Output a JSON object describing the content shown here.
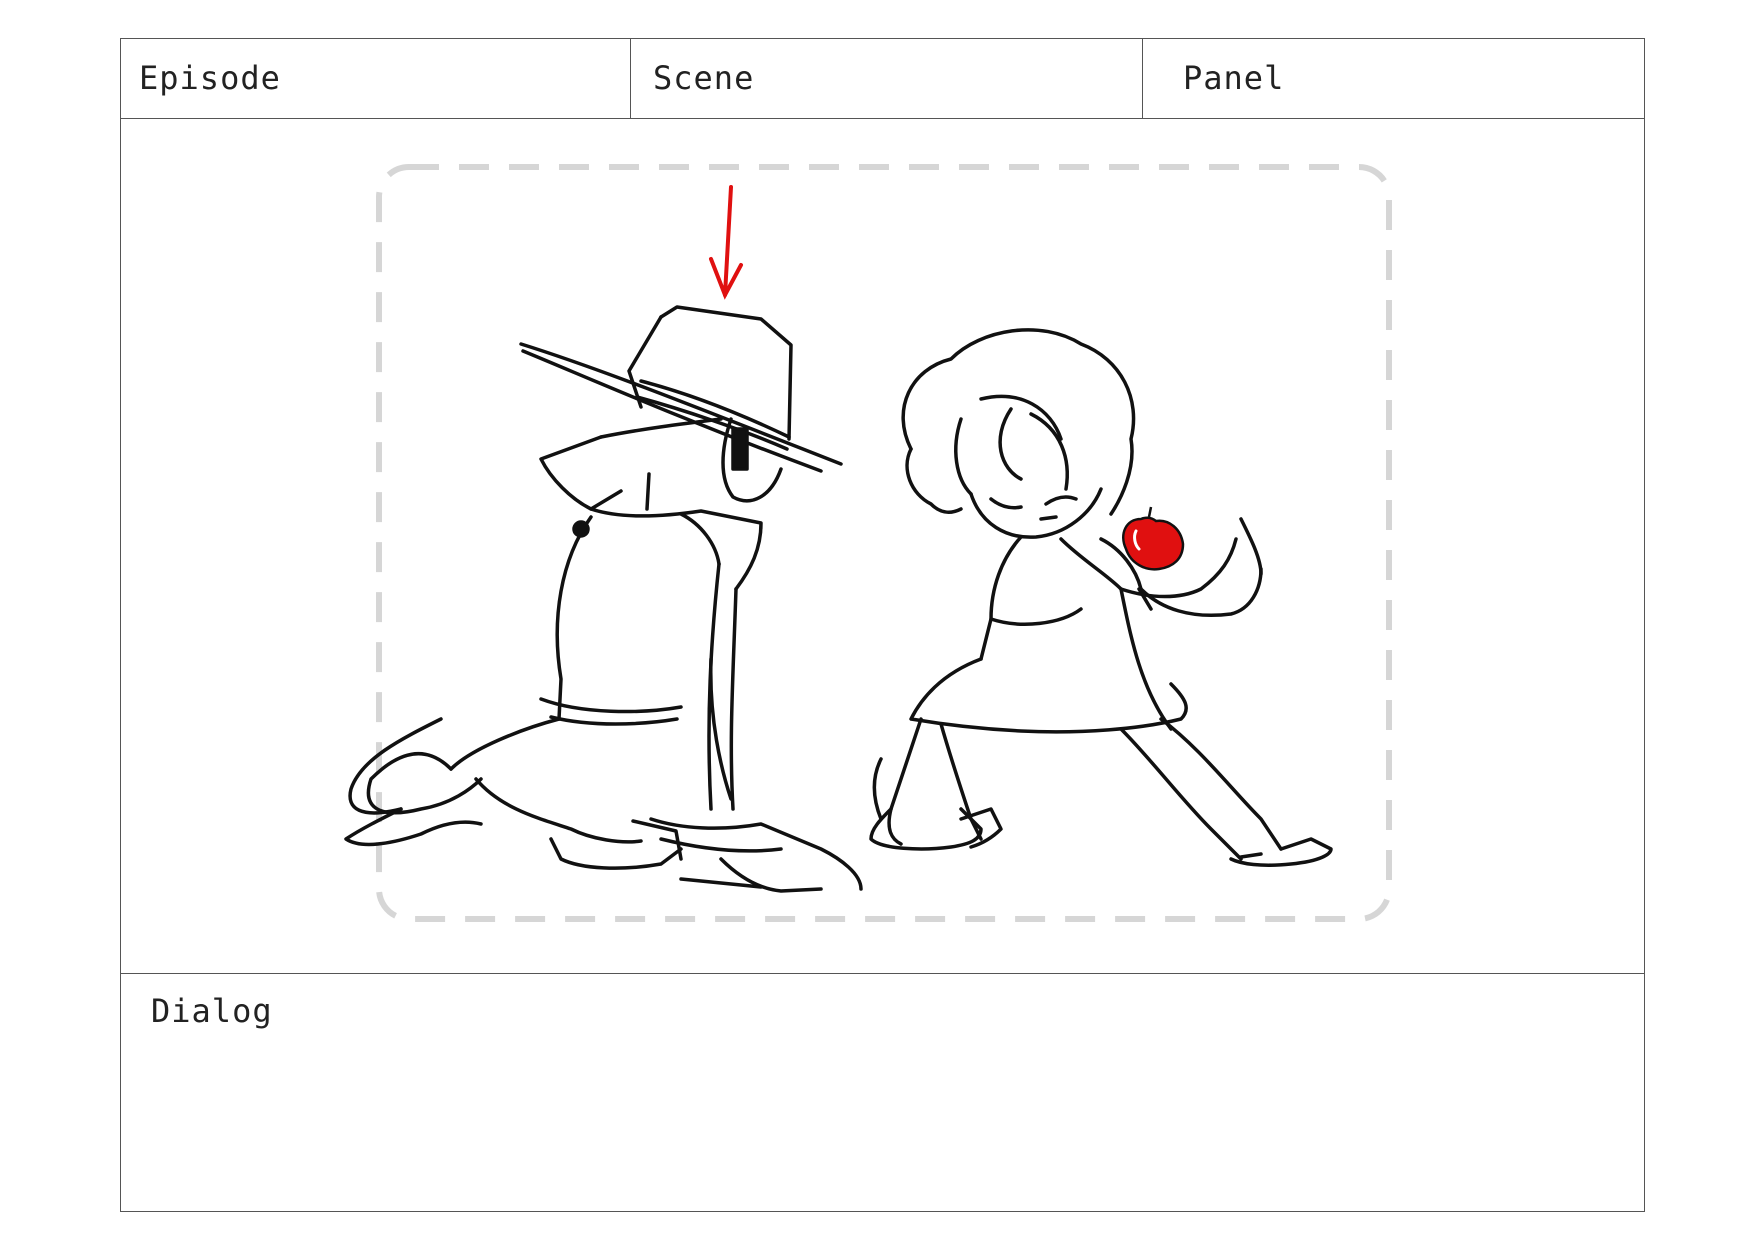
{
  "header": {
    "episode_label": "Episode",
    "scene_label": "Scene",
    "panel_label": "Panel"
  },
  "drawing": {
    "description_icons": [
      "safe-area-frame",
      "direction-arrow-icon",
      "man-in-fedora-sketch",
      "girl-with-apple-sketch",
      "apple-icon"
    ],
    "accent_color": "#e01010",
    "safe_area_color": "#cfcfcf"
  },
  "dialog": {
    "label": "Dialog"
  }
}
